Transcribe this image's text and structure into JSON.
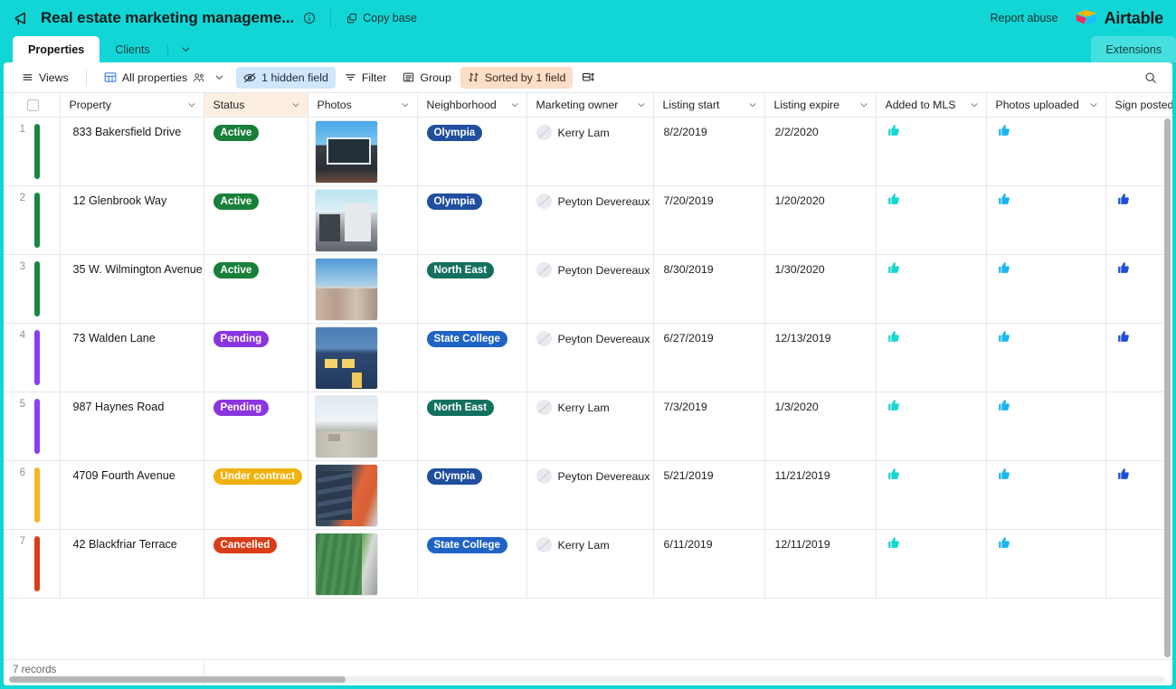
{
  "topbar": {
    "base_title": "Real estate marketing manageme...",
    "info_icon": "info-icon",
    "copy_base_label": "Copy base",
    "copy_base_icon": "copy-icon",
    "report_abuse_label": "Report abuse",
    "logo_word": "Airtable",
    "megaphone_icon": "megaphone-icon"
  },
  "tabs": {
    "items": [
      {
        "label": "Properties",
        "active": true
      },
      {
        "label": "Clients",
        "active": false
      }
    ],
    "caret_icon": "chevron-down-icon",
    "extensions_label": "Extensions"
  },
  "toolbar": {
    "views_label": "Views",
    "views_icon": "hamburger-icon",
    "view_name": "All properties",
    "view_icon": "grid-icon",
    "collaborators_icon": "people-icon",
    "view_caret_icon": "chevron-down-icon",
    "hidden_field_label": "1 hidden field",
    "hidden_field_icon": "eye-slash-icon",
    "filter_label": "Filter",
    "filter_icon": "filter-icon",
    "group_label": "Group",
    "group_icon": "group-icon",
    "sort_label": "Sorted by 1 field",
    "sort_icon": "sort-arrows-icon",
    "rowheight_icon": "row-height-icon",
    "search_icon": "search-icon"
  },
  "grid": {
    "columns": [
      {
        "name": "Property",
        "width": 159,
        "sorted": false
      },
      {
        "name": "Status",
        "width": 115,
        "sorted": true
      },
      {
        "name": "Photos",
        "width": 121,
        "sorted": false
      },
      {
        "name": "Neighborhood",
        "width": 121,
        "sorted": false
      },
      {
        "name": "Marketing owner",
        "width": 140,
        "sorted": false
      },
      {
        "name": "Listing start",
        "width": 123,
        "sorted": false
      },
      {
        "name": "Listing expire",
        "width": 123,
        "sorted": false
      },
      {
        "name": "Added to MLS",
        "width": 122,
        "sorted": false
      },
      {
        "name": "Photos uploaded",
        "width": 132,
        "sorted": false
      },
      {
        "name": "Sign posted",
        "width": 114,
        "sorted": false
      }
    ],
    "caret_icon": "chevron-down-icon",
    "select_all_checkbox": "select-all-checkbox",
    "rows": [
      {
        "num": "1",
        "bar_color": "#178844",
        "property": "833 Bakersfield Drive",
        "status": {
          "label": "Active",
          "color": "#188038"
        },
        "photo": "modern-glass-house-photo",
        "neighborhood": {
          "label": "Olympia",
          "color": "#1f4f9e"
        },
        "owner": "Kerry Lam",
        "listing_start": "8/2/2019",
        "listing_expire": "2/2/2020",
        "added_to_mls": true,
        "photos_uploaded": true,
        "sign_posted": false
      },
      {
        "num": "2",
        "bar_color": "#178844",
        "property": "12 Glenbrook Way",
        "status": {
          "label": "Active",
          "color": "#188038"
        },
        "photo": "white-modern-villa-photo",
        "neighborhood": {
          "label": "Olympia",
          "color": "#1f4f9e"
        },
        "owner": "Peyton Devereaux",
        "listing_start": "7/20/2019",
        "listing_expire": "1/20/2020",
        "added_to_mls": true,
        "photos_uploaded": true,
        "sign_posted": true
      },
      {
        "num": "3",
        "bar_color": "#178844",
        "property": "35 W. Wilmington Avenue",
        "status": {
          "label": "Active",
          "color": "#188038"
        },
        "photo": "suburban-townhouses-photo",
        "neighborhood": {
          "label": "North East",
          "color": "#13705f"
        },
        "owner": "Peyton Devereaux",
        "listing_start": "8/30/2019",
        "listing_expire": "1/30/2020",
        "added_to_mls": true,
        "photos_uploaded": true,
        "sign_posted": true
      },
      {
        "num": "4",
        "bar_color": "#8a3ff0",
        "property": "73 Walden Lane",
        "status": {
          "label": "Pending",
          "color": "#8b35e0"
        },
        "photo": "blue-colonial-house-photo",
        "neighborhood": {
          "label": "State College",
          "color": "#1f63c4"
        },
        "owner": "Peyton Devereaux",
        "listing_start": "6/27/2019",
        "listing_expire": "12/13/2019",
        "added_to_mls": true,
        "photos_uploaded": true,
        "sign_posted": true
      },
      {
        "num": "5",
        "bar_color": "#8a3ff0",
        "property": "987 Haynes Road",
        "status": {
          "label": "Pending",
          "color": "#8b35e0"
        },
        "photo": "city-skyline-hills-photo",
        "neighborhood": {
          "label": "North East",
          "color": "#13705f"
        },
        "owner": "Kerry Lam",
        "listing_start": "7/3/2019",
        "listing_expire": "1/3/2020",
        "added_to_mls": true,
        "photos_uploaded": true,
        "sign_posted": false
      },
      {
        "num": "6",
        "bar_color": "#f5b528",
        "property": "4709 Fourth Avenue",
        "status": {
          "label": "Under contract",
          "color": "#f1b10f"
        },
        "photo": "apartment-block-balconies-photo",
        "neighborhood": {
          "label": "Olympia",
          "color": "#1f4f9e"
        },
        "owner": "Peyton Devereaux",
        "listing_start": "5/21/2019",
        "listing_expire": "11/21/2019",
        "added_to_mls": true,
        "photos_uploaded": true,
        "sign_posted": true
      },
      {
        "num": "7",
        "bar_color": "#d93d1a",
        "property": "42 Blackfriar Terrace",
        "status": {
          "label": "Cancelled",
          "color": "#d93d17"
        },
        "photo": "green-lawn-aerial-photo",
        "neighborhood": {
          "label": "State College",
          "color": "#1f63c4"
        },
        "owner": "Kerry Lam",
        "listing_start": "6/11/2019",
        "listing_expire": "12/11/2019",
        "added_to_mls": true,
        "photos_uploaded": true,
        "sign_posted": false
      }
    ]
  },
  "footer": {
    "records_label": "7 records"
  },
  "colors": {
    "brand_teal": "#12d6d6",
    "sorted_header": "#fdeee2",
    "sorted_cell": "#fdf1e8",
    "mls_thumb": "#18d6d0",
    "photos_thumb": "#19b6f0",
    "sign_thumb": "#1f4fd8"
  }
}
